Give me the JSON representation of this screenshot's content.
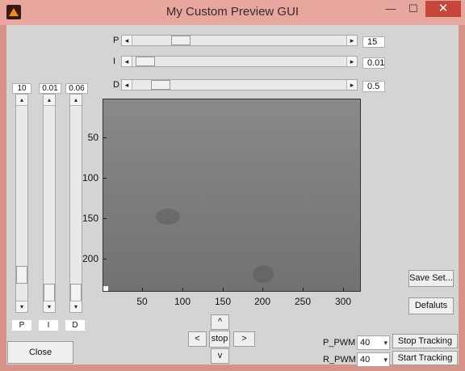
{
  "window": {
    "title": "My Custom Preview GUI",
    "min": "—",
    "max": "☐",
    "close": "✕"
  },
  "sliders": {
    "p": {
      "label": "P",
      "value": "15",
      "position": 0.2
    },
    "i": {
      "label": "I",
      "value": "0.01",
      "position": 0.02
    },
    "d": {
      "label": "D",
      "value": "0.5",
      "position": 0.1
    }
  },
  "vsliders": [
    {
      "value": "10",
      "label": "P",
      "position": 0.9
    },
    {
      "value": "0.01",
      "label": "I",
      "position": 1.0
    },
    {
      "value": "0.06",
      "label": "D",
      "position": 1.0
    }
  ],
  "plot": {
    "yticks": [
      "50",
      "100",
      "150",
      "200"
    ],
    "xticks": [
      "50",
      "100",
      "150",
      "200",
      "250",
      "300"
    ]
  },
  "nav": {
    "up": "^",
    "left": "<",
    "stop": "stop",
    "right": ">",
    "down": "v"
  },
  "buttons": {
    "save_settings": "Save Set...",
    "defaults": "Defaluts",
    "close": "Close",
    "stop_tracking": "Stop Tracking",
    "start_tracking": "Start Tracking"
  },
  "pwm": {
    "p_label": "P_PWM",
    "p_value": "40",
    "r_label": "R_PWM",
    "r_value": "40"
  },
  "icons": {
    "slider_left": "◂",
    "slider_right": "▸",
    "slider_up": "▴",
    "slider_down": "▾",
    "dropdown": "▾"
  }
}
